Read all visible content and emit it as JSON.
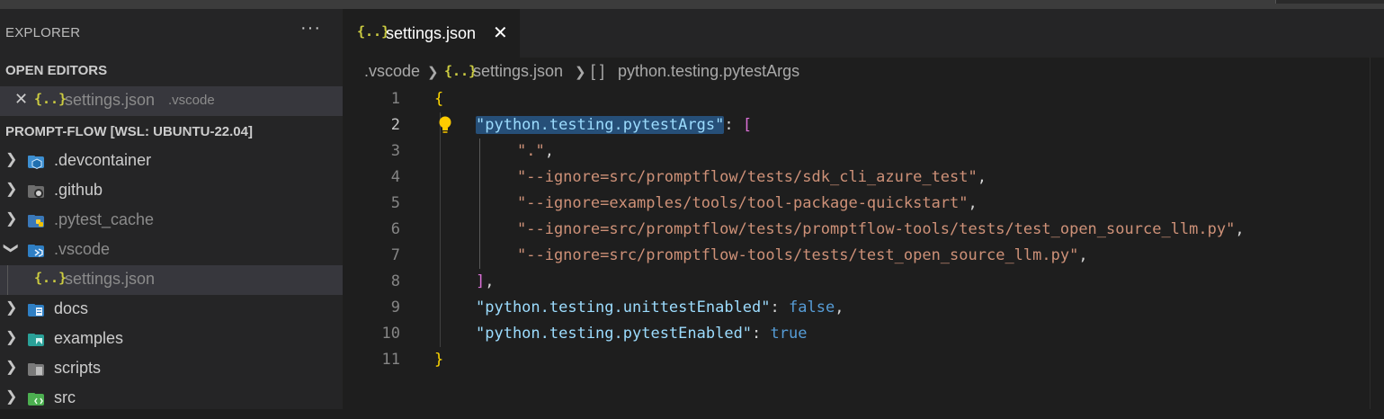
{
  "explorer": {
    "title": "EXPLORER",
    "more": "···",
    "open_editors_label": "OPEN EDITORS",
    "open_editor": {
      "close": "✕",
      "icon": "{..}",
      "name": "settings.json",
      "desc": ".vscode"
    },
    "workspace_label": "PROMPT-FLOW [WSL: UBUNTU-22.04]",
    "tree": [
      {
        "name": ".devcontainer",
        "chevron": "❯"
      },
      {
        "name": ".github",
        "chevron": "❯"
      },
      {
        "name": ".pytest_cache",
        "chevron": "❯"
      },
      {
        "name": ".vscode",
        "chevron": "❯"
      },
      {
        "name": "settings.json",
        "icon": "{..}"
      },
      {
        "name": "docs",
        "chevron": "❯"
      },
      {
        "name": "examples",
        "chevron": "❯"
      },
      {
        "name": "scripts",
        "chevron": "❯"
      },
      {
        "name": "src",
        "chevron": "❯"
      }
    ]
  },
  "tab": {
    "icon": "{..}",
    "label": "settings.json",
    "close": "✕"
  },
  "breadcrumbs": {
    "folder": ".vscode",
    "sep1": "❯",
    "file_icon": "{..}",
    "file": "settings.json",
    "sep2": "❯",
    "sym_icon": "[ ]",
    "symbol": "python.testing.pytestArgs"
  },
  "code": {
    "line_numbers": [
      "1",
      "2",
      "3",
      "4",
      "5",
      "6",
      "7",
      "8",
      "9",
      "10",
      "11"
    ],
    "l1": "{",
    "l2_key": "\"python.testing.pytestArgs\"",
    "l2_colon": ": ",
    "l2_bracket": "[",
    "l3": "\".\"",
    "l4": "\"--ignore=src/promptflow/tests/sdk_cli_azure_test\"",
    "l5": "\"--ignore=examples/tools/tool-package-quickstart\"",
    "l6": "\"--ignore=src/promptflow/tests/promptflow-tools/tests/test_open_source_llm.py\"",
    "l7": "\"--ignore=src/promptflow-tools/tests/test_open_source_llm.py\"",
    "comma": ",",
    "l8_bracket": "]",
    "l9_key": "\"python.testing.unittestEnabled\"",
    "l9_colon": ": ",
    "l9_val": "false",
    "l10_key": "\"python.testing.pytestEnabled\"",
    "l10_colon": ": ",
    "l10_val": "true",
    "l11": "}"
  },
  "colors": {
    "key": "#9cdcfe",
    "string": "#ce9178",
    "boolean": "#569cd6",
    "brace": "#ffd700",
    "bracket": "#da70d6",
    "selection": "#264f78"
  }
}
